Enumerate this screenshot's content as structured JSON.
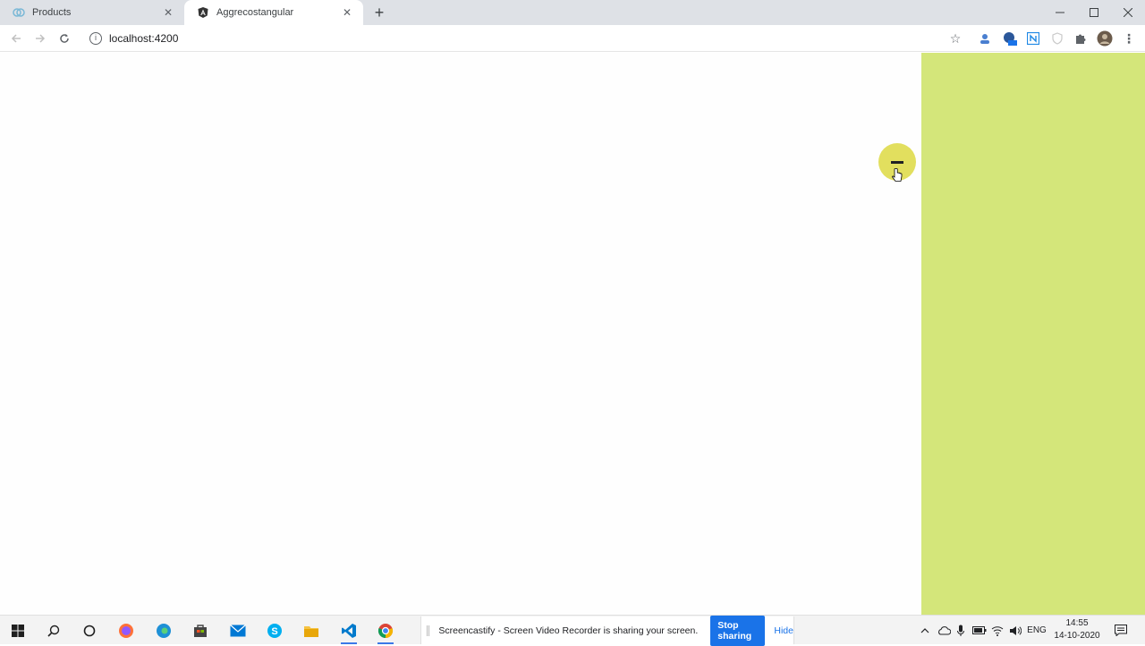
{
  "browser": {
    "tabs": [
      {
        "title": "Products",
        "active": false
      },
      {
        "title": "Aggrecostangular",
        "active": true
      }
    ],
    "url": "localhost:4200"
  },
  "page": {
    "side_panel_color": "#d4e67a",
    "toggle_color": "#e2df5e"
  },
  "taskbar": {
    "share": {
      "message": "Screencastify - Screen Video Recorder is sharing your screen.",
      "stop_label": "Stop sharing",
      "hide_label": "Hide"
    },
    "language": "ENG",
    "time": "14:55",
    "date": "14-10-2020"
  }
}
